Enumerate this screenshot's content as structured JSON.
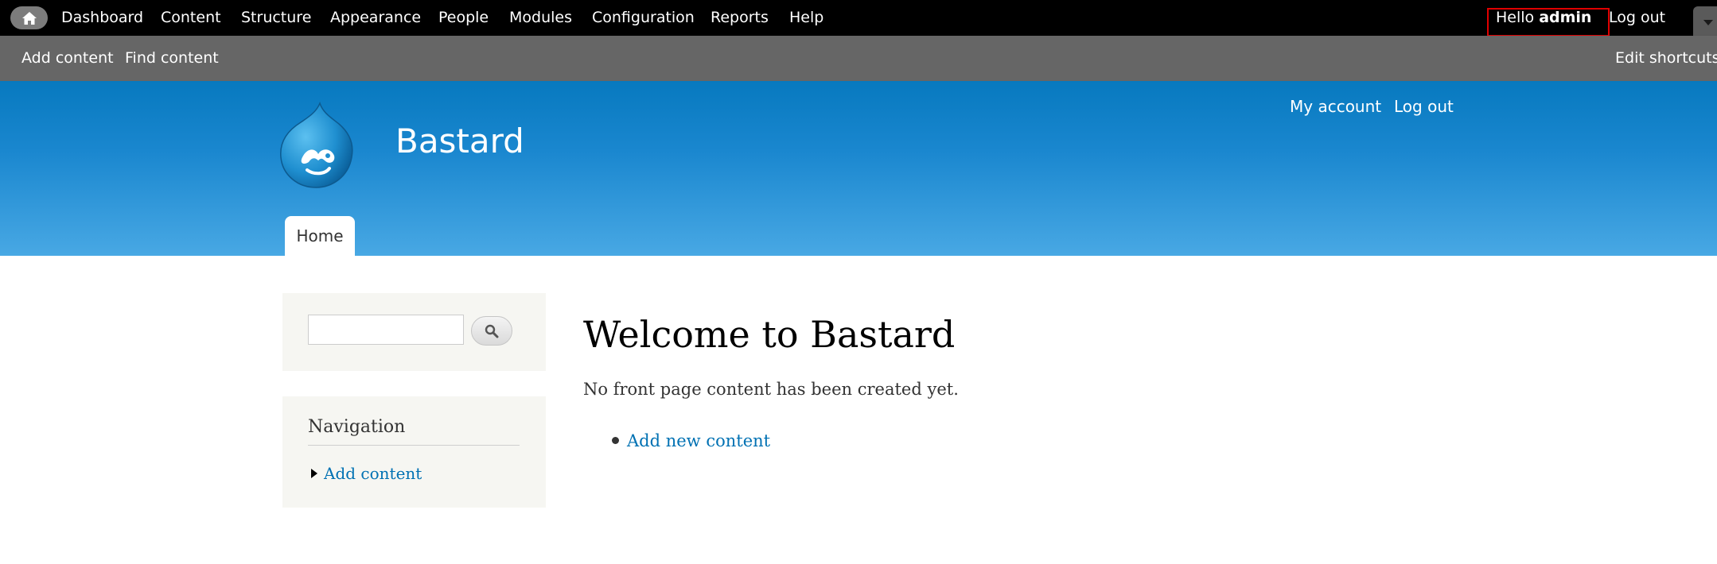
{
  "admin_menu": {
    "items": [
      "Dashboard",
      "Content",
      "Structure",
      "Appearance",
      "People",
      "Modules",
      "Configuration",
      "Reports",
      "Help"
    ],
    "hello_prefix": "Hello ",
    "username": "admin",
    "logout": "Log out"
  },
  "shortcuts": {
    "add_content": "Add content",
    "find_content": "Find content",
    "edit_shortcuts": "Edit shortcuts"
  },
  "header": {
    "site_name": "Bastard",
    "my_account": "My account",
    "logout": "Log out",
    "home_tab": "Home"
  },
  "sidebar": {
    "search_placeholder": "",
    "navigation_title": "Navigation",
    "nav_link": "Add content"
  },
  "main": {
    "title": "Welcome to Bastard",
    "message": "No front page content has been created yet.",
    "link": "Add new content"
  },
  "colors": {
    "admin_bar": "#000000",
    "shortcut_bar": "#666666",
    "header_blue": "#1a87cf",
    "link_blue": "#0071b3",
    "highlight_red": "#e00000"
  }
}
